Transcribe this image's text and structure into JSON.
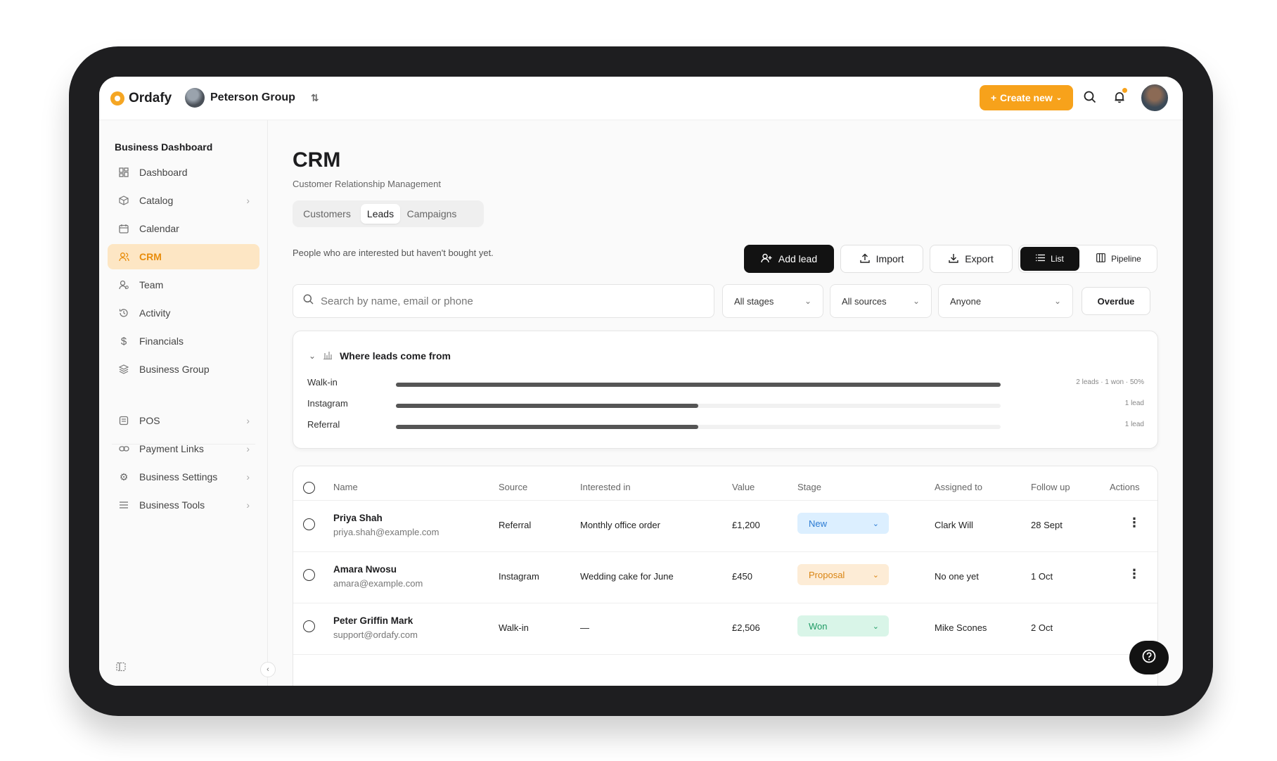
{
  "app": {
    "name": "Ordafy",
    "org": "Peterson Group"
  },
  "topbar": {
    "create_label": "Create new"
  },
  "sidebar": {
    "heading": "Business Dashboard",
    "items": [
      {
        "label": "Dashboard",
        "icon": "dashboard-icon"
      },
      {
        "label": "Catalog",
        "icon": "box-icon",
        "chevron": true
      },
      {
        "label": "Calendar",
        "icon": "calendar-icon"
      },
      {
        "label": "CRM",
        "icon": "users-icon",
        "active": true
      },
      {
        "label": "Team",
        "icon": "user-icon"
      },
      {
        "label": "Activity",
        "icon": "history-icon"
      },
      {
        "label": "Financials",
        "icon": "dollar-icon"
      },
      {
        "label": "Business Group",
        "icon": "layers-icon"
      },
      {
        "label": "POS",
        "icon": "register-icon",
        "chevron": true
      },
      {
        "label": "Payment Links",
        "icon": "link-icon",
        "chevron": true
      },
      {
        "label": "Business Settings",
        "icon": "gear-icon",
        "chevron": true
      },
      {
        "label": "Business Tools",
        "icon": "menu-icon",
        "chevron": true
      }
    ]
  },
  "page": {
    "title": "CRM",
    "subtitle": "Customer Relationship Management",
    "tabs": [
      "Customers",
      "Leads",
      "Campaigns"
    ],
    "active_tab": "Leads",
    "hint": "People who are interested but haven't bought yet."
  },
  "actions": {
    "add_lead": "Add lead",
    "import": "Import",
    "export": "Export",
    "view_list": "List",
    "view_pipeline": "Pipeline"
  },
  "filters": {
    "search_placeholder": "Search by name, email or phone",
    "stages": "All stages",
    "sources": "All sources",
    "assignee": "Anyone",
    "overdue": "Overdue"
  },
  "sources": {
    "title": "Where leads come from",
    "rows": [
      {
        "label": "Walk-in",
        "fraction": 1.0,
        "stat": "2 leads · 1 won · 50%"
      },
      {
        "label": "Instagram",
        "fraction": 0.5,
        "stat": "1 lead"
      },
      {
        "label": "Referral",
        "fraction": 0.5,
        "stat": "1 lead"
      }
    ]
  },
  "table": {
    "headers": [
      "Name",
      "Source",
      "Interested in",
      "Value",
      "Stage",
      "Assigned to",
      "Follow up",
      "Actions"
    ],
    "rows": [
      {
        "name": "Priya Shah",
        "email": "priya.shah@example.com",
        "source": "Referral",
        "interest": "Monthly office order",
        "value": "£1,200",
        "stage": "New",
        "assigned": "Clark Will",
        "followup": "28 Sept"
      },
      {
        "name": "Amara Nwosu",
        "email": "amara@example.com",
        "source": "Instagram",
        "interest": "Wedding cake for June",
        "value": "£450",
        "stage": "Proposal",
        "assigned": "No one yet",
        "followup": "1 Oct"
      },
      {
        "name": "Peter Griffin Mark",
        "email": "support@ordafy.com",
        "source": "Walk-in",
        "interest": "—",
        "value": "£2,506",
        "stage": "Won",
        "assigned": "Mike Scones",
        "followup": "2 Oct"
      }
    ]
  },
  "colors": {
    "accent": "#f7a21b",
    "active_bg": "#fde6c4",
    "stage_new": "#dcefff",
    "stage_proposal": "#fdecd6",
    "stage_won": "#d9f5e8"
  }
}
